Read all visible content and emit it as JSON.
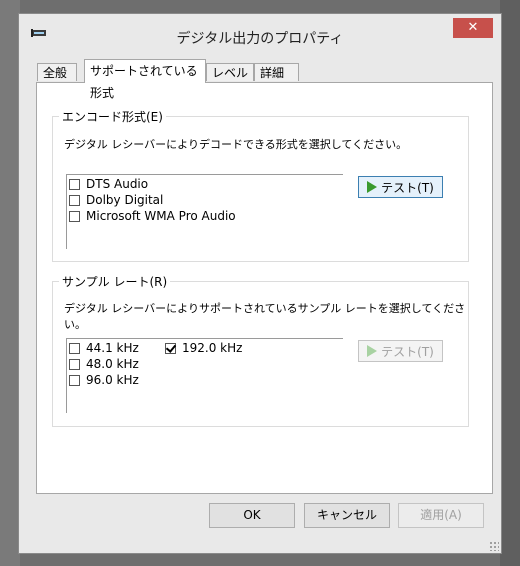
{
  "window": {
    "title": "デジタル出力のプロパティ",
    "close_label": "✕"
  },
  "tabs": [
    {
      "label": "全般"
    },
    {
      "label": "サポートされている形式"
    },
    {
      "label": "レベル"
    },
    {
      "label": "詳細"
    }
  ],
  "encode_group": {
    "title": "エンコード形式(E)",
    "description": "デジタル レシーバーによりデコードできる形式を選択してください。",
    "formats": [
      {
        "label": "DTS Audio",
        "checked": false
      },
      {
        "label": "Dolby Digital",
        "checked": false
      },
      {
        "label": "Microsoft WMA Pro Audio",
        "checked": false
      }
    ],
    "test_label": "テスト(T)"
  },
  "sample_group": {
    "title": "サンプル レート(R)",
    "description": "デジタル レシーバーによりサポートされているサンプル レートを選択してください。",
    "rates": [
      {
        "label": "44.1 kHz",
        "checked": false
      },
      {
        "label": "48.0 kHz",
        "checked": false
      },
      {
        "label": "96.0 kHz",
        "checked": false
      },
      {
        "label": "192.0 kHz",
        "checked": true
      }
    ],
    "test_label": "テスト(T)"
  },
  "buttons": {
    "ok": "OK",
    "cancel": "キャンセル",
    "apply": "適用(A)"
  }
}
